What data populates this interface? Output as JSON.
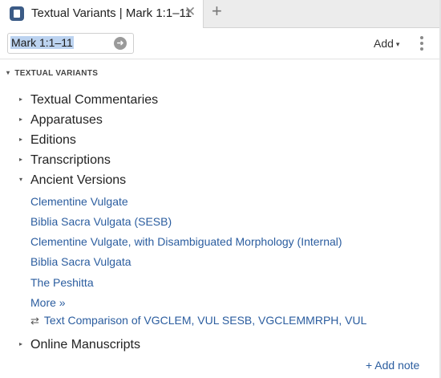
{
  "tab": {
    "title": "Textual Variants | Mark 1:1–11",
    "close_glyph": "✕",
    "add_glyph": "+"
  },
  "toolbar": {
    "reference_value": "Mark 1:1–11",
    "go_glyph": "➜",
    "add_label": "Add",
    "add_caret": "▾"
  },
  "section": {
    "title": "TEXTUAL VARIANTS",
    "caret": "▾"
  },
  "tree": {
    "collapsed_caret": "▸",
    "expanded_caret": "▾",
    "items": [
      {
        "label": "Textual Commentaries",
        "expanded": false
      },
      {
        "label": "Apparatuses",
        "expanded": false
      },
      {
        "label": "Editions",
        "expanded": false
      },
      {
        "label": "Transcriptions",
        "expanded": false
      },
      {
        "label": "Ancient Versions",
        "expanded": true
      },
      {
        "label": "Online Manuscripts",
        "expanded": false
      }
    ],
    "ancient_versions": [
      "Clementine Vulgate",
      "Biblia Sacra Vulgata (SESB)",
      "Clementine Vulgate, with Disambiguated Morphology (Internal)",
      "Biblia Sacra Vulgata",
      "The Peshitta"
    ],
    "more_label": "More »",
    "compare_glyph": "⇄",
    "compare_label": "Text Comparison of VGCLEM, VUL SESB, VGCLEMMRPH, VUL"
  },
  "footer": {
    "add_note_label": "+ Add note"
  },
  "colors": {
    "link": "#2b5d9f",
    "tab_icon": "#3b5b86",
    "selection": "#bcd3f0"
  },
  "icons": [
    "resource-icon",
    "close-icon",
    "plus-icon",
    "go-arrow-icon",
    "chevron-down-icon",
    "more-vertical-icon",
    "chevron-right-icon",
    "compare-icon"
  ]
}
